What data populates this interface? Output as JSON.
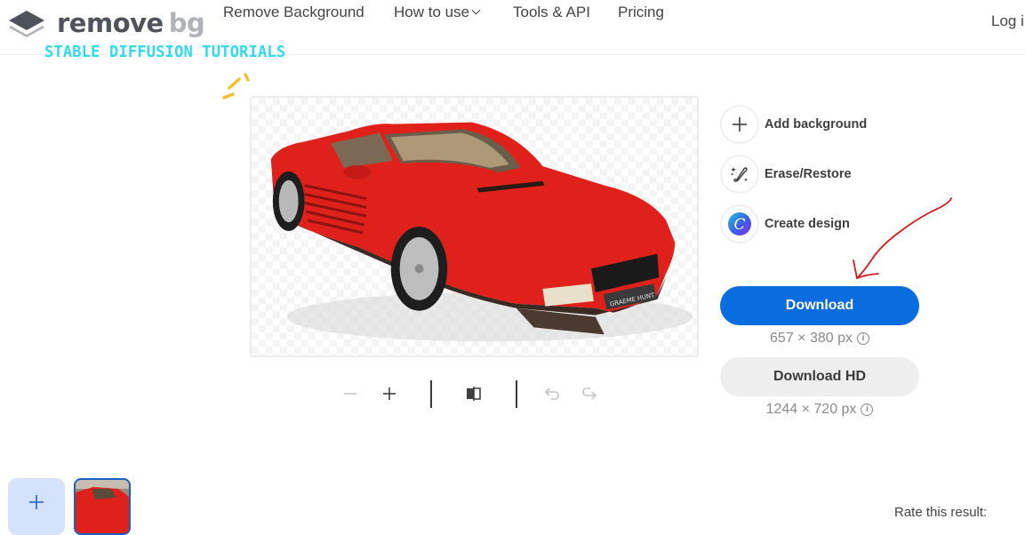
{
  "header": {
    "logo": {
      "primary": "remove",
      "secondary": "bg",
      "icon": "layers-logo-icon"
    },
    "watermark": "STABLE DIFFUSION TUTORIALS",
    "nav": [
      {
        "label": "Remove Background",
        "has_dropdown": false
      },
      {
        "label": "How to use",
        "has_dropdown": true
      },
      {
        "label": "Tools & API",
        "has_dropdown": false
      },
      {
        "label": "Pricing",
        "has_dropdown": false
      }
    ],
    "login": "Log in"
  },
  "preview": {
    "subject": "Red Ferrari Testarossa with background removed",
    "plate_text": "GRAEME HUNT",
    "colors": {
      "car": "#e0211b",
      "checker": "#f4f4f4"
    }
  },
  "toolbar": {
    "zoom_out": "minus-icon",
    "zoom_in": "plus-icon",
    "compare": "compare-icon",
    "undo": "undo-icon",
    "redo": "redo-icon"
  },
  "side_actions": [
    {
      "label": "Add background",
      "icon": "plus-icon"
    },
    {
      "label": "Erase/Restore",
      "icon": "brush-sparkle-icon"
    },
    {
      "label": "Create design",
      "icon": "canva-icon"
    }
  ],
  "download": {
    "label": "Download",
    "dims": "657 × 380 px",
    "color": "#0a6ddf"
  },
  "download_hd": {
    "label": "Download HD",
    "dims": "1244 × 720 px"
  },
  "info_glyph": "i",
  "bottom": {
    "add_glyph": "+",
    "rate_text": "Rate this result:"
  },
  "annotation": {
    "type": "hand-drawn arrow",
    "color": "#d41a1a",
    "points_to": "Download"
  }
}
